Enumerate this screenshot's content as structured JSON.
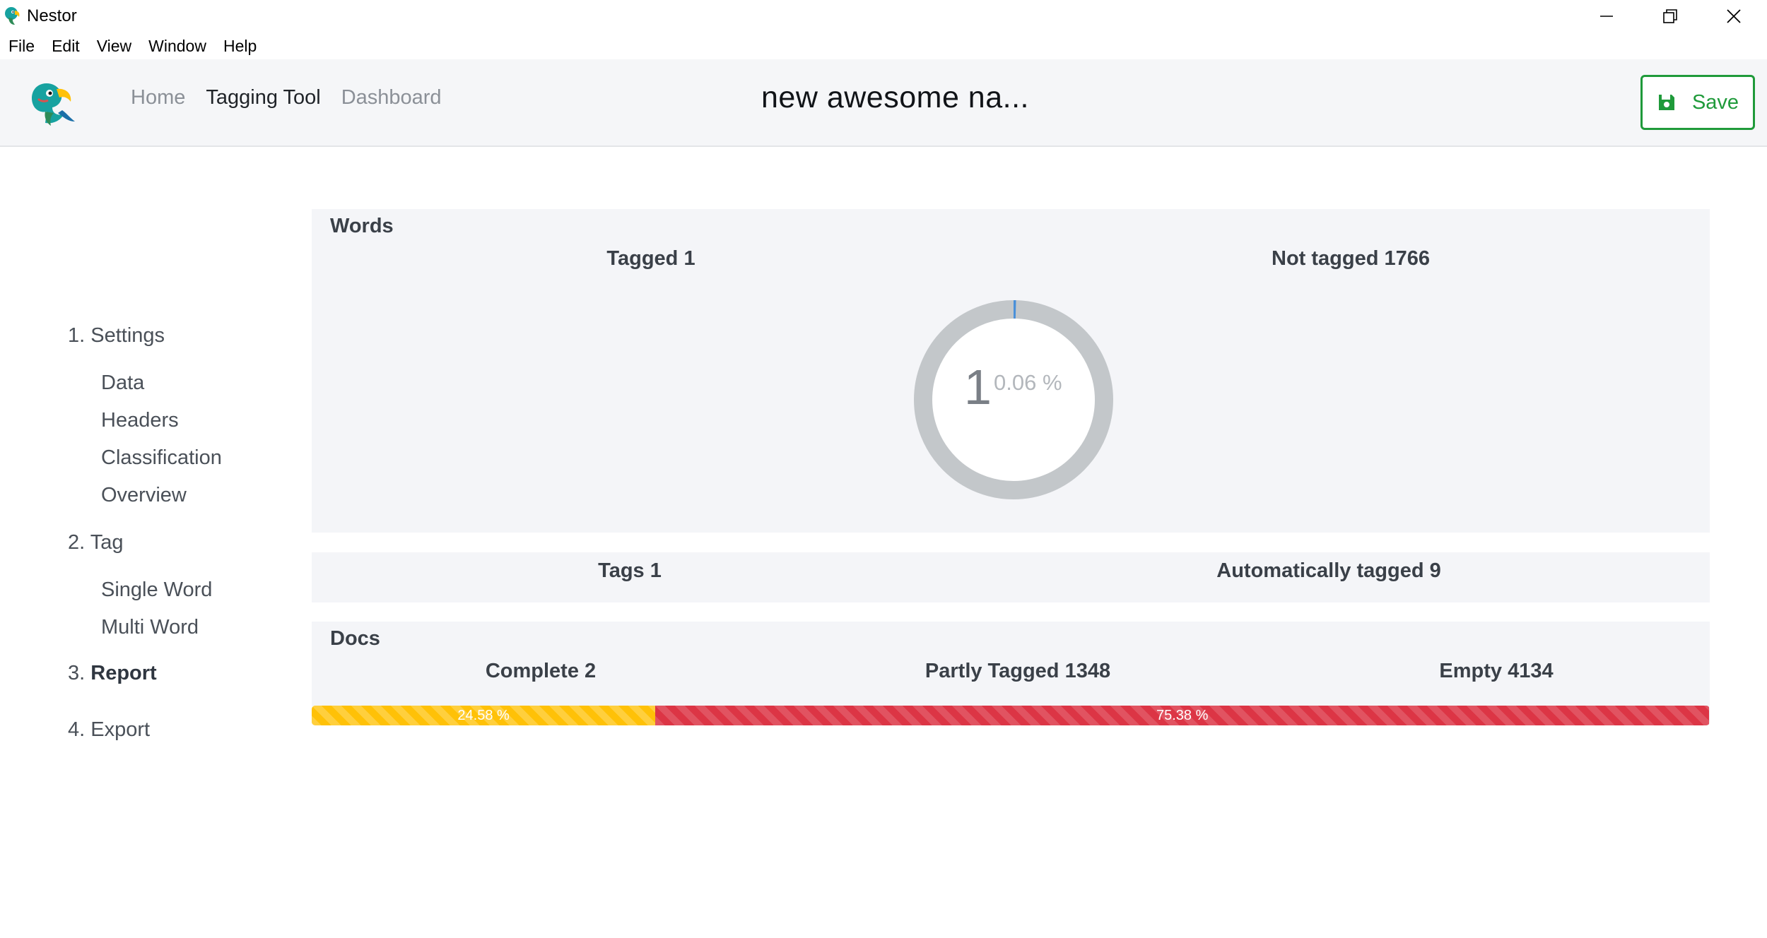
{
  "window": {
    "title": "Nestor",
    "controls": [
      "minimize-icon",
      "restore-icon",
      "close-icon"
    ]
  },
  "menubar": {
    "items": [
      "File",
      "Edit",
      "View",
      "Window",
      "Help"
    ]
  },
  "header": {
    "nav": [
      {
        "label": "Home",
        "active": false
      },
      {
        "label": "Tagging Tool",
        "active": true
      },
      {
        "label": "Dashboard",
        "active": false
      }
    ],
    "project_title": "new awesome na...",
    "save_label": "Save"
  },
  "sidebar": {
    "steps": [
      {
        "label": "1. Settings",
        "substeps": [
          "Data",
          "Headers",
          "Classification",
          "Overview"
        ]
      },
      {
        "label": "2. Tag",
        "substeps": [
          "Single Word",
          "Multi Word"
        ]
      },
      {
        "num": "3.",
        "label": "Report",
        "current": true
      },
      {
        "label": "4. Export"
      }
    ]
  },
  "words": {
    "title": "Words",
    "tagged_label": "Tagged 1",
    "not_tagged_label": "Not tagged 1766",
    "donut_count": "1",
    "donut_percent": "0.06 %",
    "tagged_fraction": 0.0006
  },
  "tags": {
    "tags_label": "Tags 1",
    "auto_label": "Automatically tagged 9"
  },
  "docs": {
    "title": "Docs",
    "complete_label": "Complete 2",
    "partly_label": "Partly Tagged 1348",
    "empty_label": "Empty 4134",
    "partly_percent": 24.58,
    "partly_percent_label": "24.58 %",
    "empty_percent": 75.38,
    "empty_percent_label": "75.38 %"
  },
  "colors": {
    "save_green": "#1f9a3a",
    "partly_yellow": "#ffc107",
    "empty_red": "#dc3545",
    "donut_track": "#c3c7ca",
    "donut_fill": "#4a90d9"
  }
}
